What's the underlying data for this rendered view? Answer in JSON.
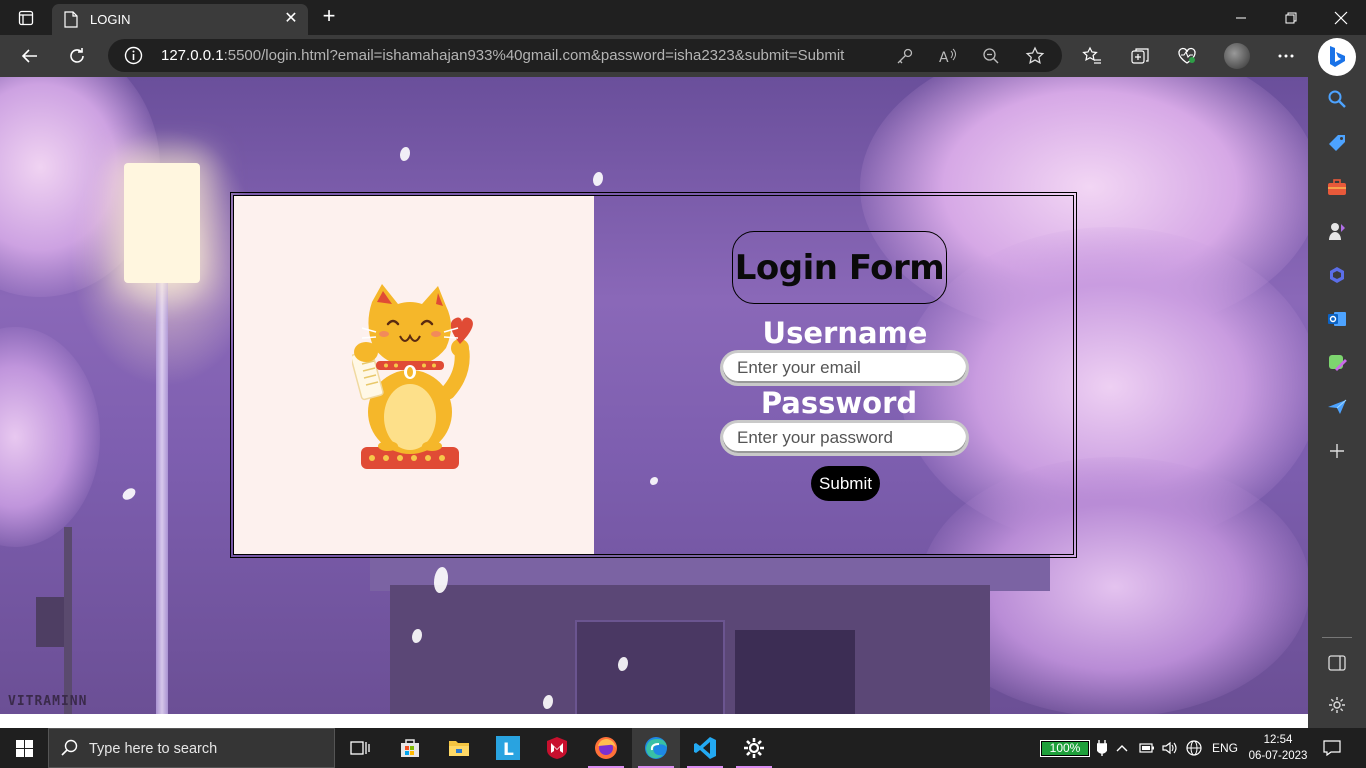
{
  "browser": {
    "tab_title": "LOGIN",
    "new_tab_symbol": "+",
    "close_tab_symbol": "✕",
    "url_host": "127.0.0.1",
    "url_rest": ":5500/login.html?email=ishamahajan933%40gmail.com&password=isha2323&submit=Submit"
  },
  "page": {
    "watermark": "VITRAMINN",
    "form_title": "Login Form",
    "username_label": "Username",
    "email_placeholder": "Enter your email",
    "password_label": "Password",
    "password_placeholder": "Enter your password",
    "submit_label": "Submit"
  },
  "taskbar": {
    "search_placeholder": "Type here to search",
    "battery_percent": "100%",
    "battery_level": 1.0,
    "language": "ENG",
    "time": "12:54",
    "date": "06-07-2023"
  },
  "colors": {
    "accent": "#d98cf0",
    "form_bg_left": "#fdf1ee",
    "battery_green": "#1e9f3a"
  }
}
